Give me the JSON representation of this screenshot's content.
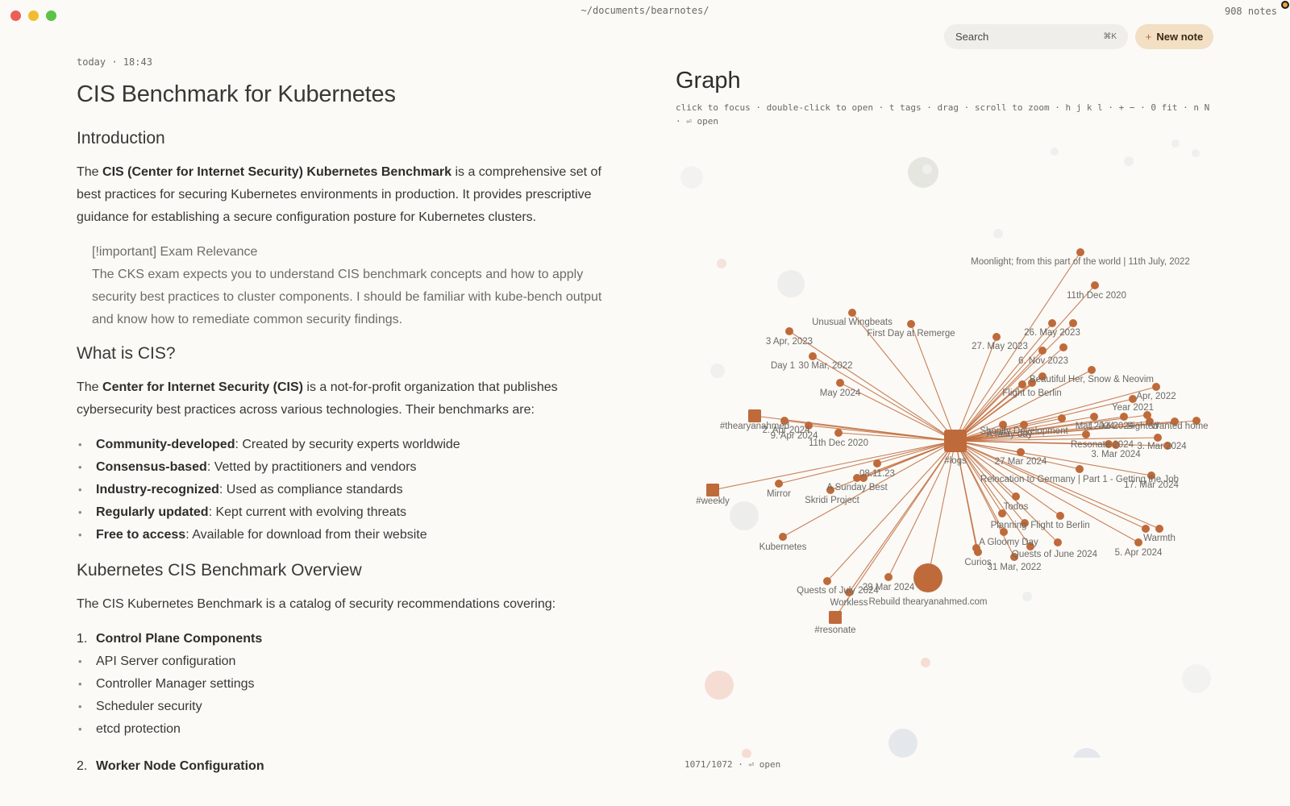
{
  "window": {
    "path": "~/documents/bearnotes/",
    "note_count": "908 notes"
  },
  "toolbar": {
    "search_placeholder": "Search",
    "search_shortcut": "⌘K",
    "new_note_icon": "+",
    "new_note_label": "New note"
  },
  "note": {
    "timestamp": "today · 18:43",
    "title": "CIS Benchmark for Kubernetes",
    "intro_heading": "Introduction",
    "intro_p": {
      "prefix": "The ",
      "bold": "CIS (Center for Internet Security) Kubernetes Benchmark",
      "suffix": " is a comprehensive set of best practices for securing Kubernetes environments in production. It provides prescriptive guidance for establishing a secure configuration posture for Kubernetes clusters."
    },
    "callout": {
      "title": "[!important] Exam Relevance",
      "body": "The CKS exam expects you to understand CIS benchmark concepts and how to apply security best practices to cluster components. I should be familiar with kube-bench output and know how to remediate common security findings."
    },
    "what_heading": "What is CIS?",
    "what_p": {
      "prefix": "The ",
      "bold": "Center for Internet Security (CIS)",
      "suffix": " is a not-for-profit organization that publishes cybersecurity best practices across various technologies. Their benchmarks are:"
    },
    "features": [
      {
        "bold": "Community-developed",
        "text": ": Created by security experts worldwide"
      },
      {
        "bold": "Consensus-based",
        "text": ": Vetted by practitioners and vendors"
      },
      {
        "bold": "Industry-recognized",
        "text": ": Used as compliance standards"
      },
      {
        "bold": "Regularly updated",
        "text": ": Kept current with evolving threats"
      },
      {
        "bold": "Free to access",
        "text": ": Available for download from their website"
      }
    ],
    "overview_heading": "Kubernetes CIS Benchmark Overview",
    "overview_p": "The CIS Kubernetes Benchmark is a catalog of security recommendations covering:",
    "section1_num": "1.",
    "section1_title": "Control Plane Components",
    "section1_items": [
      "API Server configuration",
      "Controller Manager settings",
      "Scheduler security",
      "etcd protection"
    ],
    "section2_num": "2.",
    "section2_title": "Worker Node Configuration"
  },
  "graph": {
    "title": "Graph",
    "hint": "click to focus · double-click to open · t tags · drag · scroll to zoom · h j k l · + − · 0 fit · n N · ⏎ open",
    "footer": "1071/1072 · ⏎ open",
    "accent_color": "#bf6a3a",
    "hub_label": "#logs",
    "nodes": [
      "Moonlight; from this part of the world | 11th July, 2022",
      "11th Dec 2020",
      "26. May 2023",
      "27. May 2023",
      "6. Nov 2023",
      "Unusual Wingbeats",
      "First Day at Remerge",
      "3 Apr, 2023",
      "Day 1",
      "30 Mar, 2022",
      "May 2024",
      "Beautiful Her, Snow & Neovim",
      "Flight to Berlin",
      "Apr, 2022",
      "Year 2021",
      "#thearyanahmed",
      "2. Apr 2024",
      "9. Apr 2024",
      "11th Dec 2020",
      "Shopify Development",
      "1. Jul 2024",
      "Sighted",
      "Wanted home",
      "Mar 2024",
      "A rainy day",
      "3. Mar 2024",
      "3. Mar 2024",
      "Resonate 2024",
      "27 Mar 2024",
      "Relocation to Germany | Part 1 - Getting the Job",
      "17. Mar 2024",
      "#weekly",
      "Mirror",
      "A Sunday Best",
      "08.11.23",
      "Skridi Project",
      "Todos",
      "Flight to Berlin",
      "Planning",
      "A Gloomy Day",
      "Warmth",
      "5. Apr 2024",
      "Quests of June 2024",
      "Curios",
      "31 Mar, 2022",
      "Kubernetes",
      "Quests of July 2024",
      "29 Mar 2024",
      "Workless",
      "Rebuild thearyanahmed.com",
      "#resonate"
    ]
  }
}
